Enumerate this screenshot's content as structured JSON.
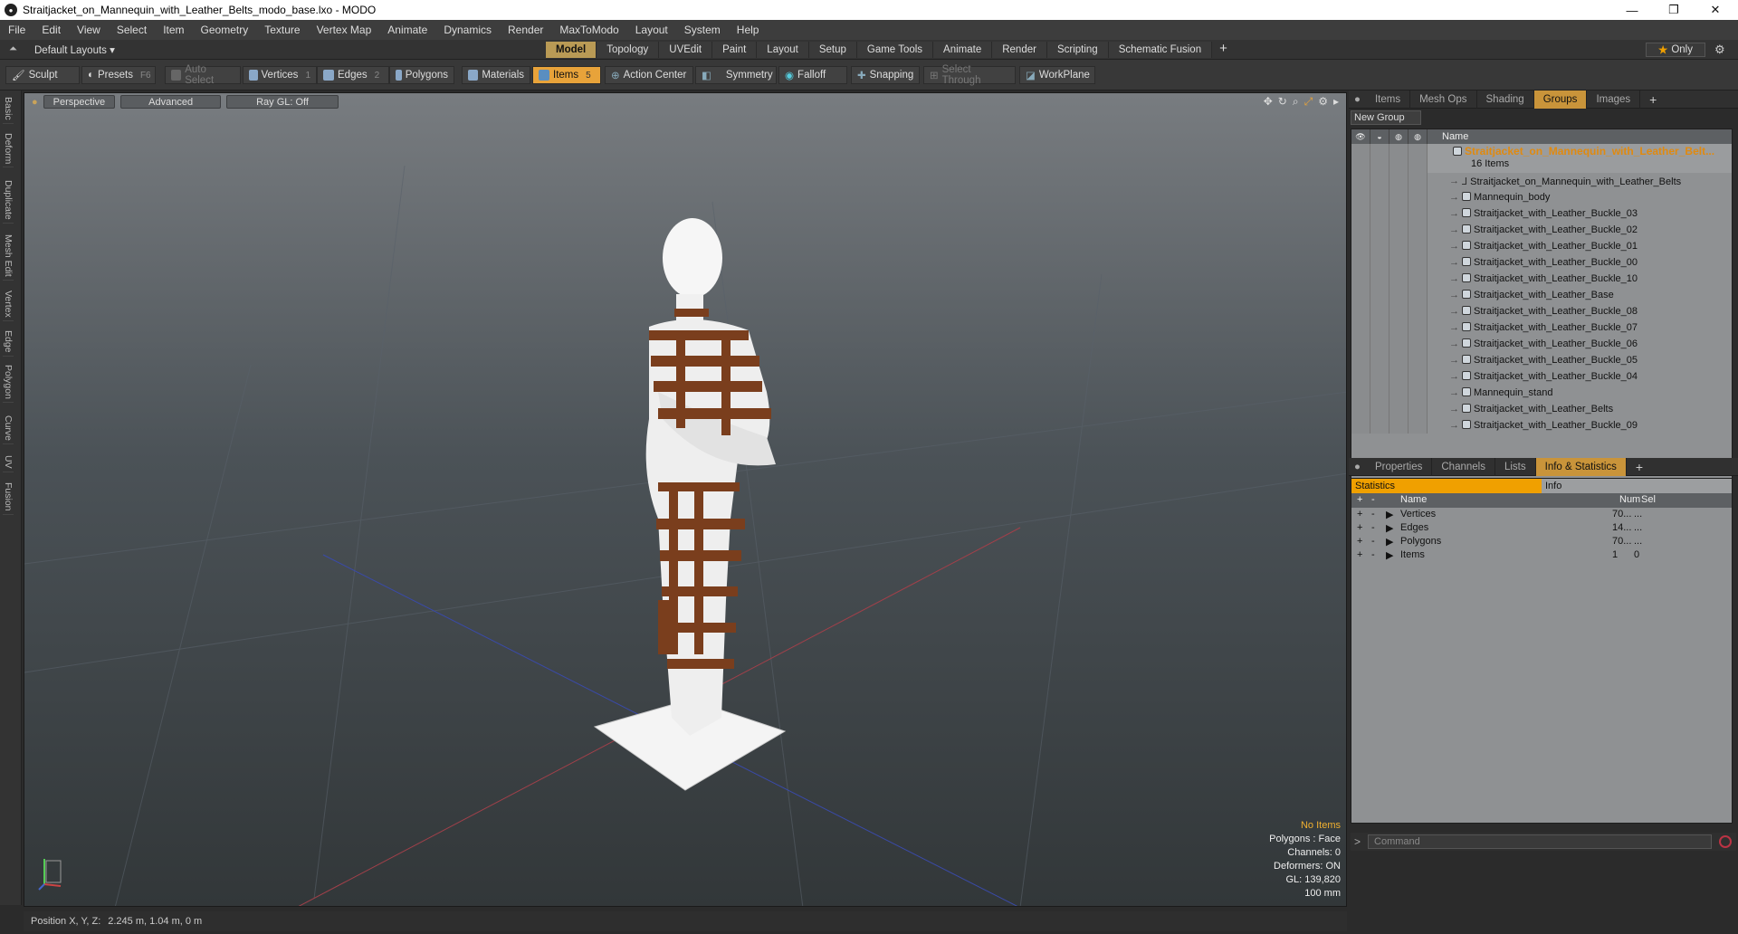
{
  "window": {
    "title": "Straitjacket_on_Mannequin_with_Leather_Belts_modo_base.lxo - MODO"
  },
  "menu": [
    "File",
    "Edit",
    "View",
    "Select",
    "Item",
    "Geometry",
    "Texture",
    "Vertex Map",
    "Animate",
    "Dynamics",
    "Render",
    "MaxToModo",
    "Layout",
    "System",
    "Help"
  ],
  "layout": {
    "name": "Default Layouts",
    "tabs": [
      "Model",
      "Topology",
      "UVEdit",
      "Paint",
      "Layout",
      "Setup",
      "Game Tools",
      "Animate",
      "Render",
      "Scripting",
      "Schematic Fusion"
    ],
    "active_tab": "Model",
    "plus": "+",
    "only": "Only",
    "only_star": "★"
  },
  "toolbar": {
    "sculpt": "Sculpt",
    "presets": "Presets",
    "presets_key": "F6",
    "auto_select": "Auto Select",
    "vertices": "Vertices",
    "vertices_key": "1",
    "edges": "Edges",
    "edges_key": "2",
    "polygons": "Polygons",
    "materials": "Materials",
    "items": "Items",
    "items_key": "5",
    "action_center": "Action Center",
    "symmetry": "Symmetry",
    "falloff": "Falloff",
    "snapping": "Snapping",
    "select_through": "Select Through",
    "workplane": "WorkPlane"
  },
  "left_tabs": [
    "Basic",
    "Deform",
    "Duplicate",
    "Mesh Edit",
    "Vertex",
    "Edge",
    "Polygon",
    "Curve",
    "UV",
    "Fusion"
  ],
  "viewport": {
    "view": "Perspective",
    "shading": "Advanced",
    "raygl": "Ray GL: Off",
    "info": {
      "no_items": "No Items",
      "polygons": "Polygons : Face",
      "channels": "Channels: 0",
      "deformers": "Deformers: ON",
      "gl": "GL: 139,820",
      "scale": "100 mm"
    }
  },
  "status": {
    "label": "Position X, Y, Z:",
    "value": "2.245 m, 1.04 m, 0 m"
  },
  "groups_panel": {
    "tabs": [
      "Items",
      "Mesh Ops",
      "Shading",
      "Groups",
      "Images"
    ],
    "active_tab": "Groups",
    "new_group": "New Group",
    "name_header": "Name",
    "root": {
      "name": "Straitjacket_on_Mannequin_with_Leather_Belt...",
      "count": "16 Items"
    },
    "items": [
      {
        "name": "Straitjacket_on_Mannequin_with_Leather_Belts",
        "type": "locator"
      },
      {
        "name": "Mannequin_body",
        "type": "mesh"
      },
      {
        "name": "Straitjacket_with_Leather_Buckle_03",
        "type": "mesh"
      },
      {
        "name": "Straitjacket_with_Leather_Buckle_02",
        "type": "mesh"
      },
      {
        "name": "Straitjacket_with_Leather_Buckle_01",
        "type": "mesh"
      },
      {
        "name": "Straitjacket_with_Leather_Buckle_00",
        "type": "mesh"
      },
      {
        "name": "Straitjacket_with_Leather_Buckle_10",
        "type": "mesh"
      },
      {
        "name": "Straitjacket_with_Leather_Base",
        "type": "mesh"
      },
      {
        "name": "Straitjacket_with_Leather_Buckle_08",
        "type": "mesh"
      },
      {
        "name": "Straitjacket_with_Leather_Buckle_07",
        "type": "mesh"
      },
      {
        "name": "Straitjacket_with_Leather_Buckle_06",
        "type": "mesh"
      },
      {
        "name": "Straitjacket_with_Leather_Buckle_05",
        "type": "mesh"
      },
      {
        "name": "Straitjacket_with_Leather_Buckle_04",
        "type": "mesh"
      },
      {
        "name": "Mannequin_stand",
        "type": "mesh"
      },
      {
        "name": "Straitjacket_with_Leather_Belts",
        "type": "mesh"
      },
      {
        "name": "Straitjacket_with_Leather_Buckle_09",
        "type": "mesh"
      }
    ]
  },
  "stats_panel": {
    "tabs": [
      "Properties",
      "Channels",
      "Lists",
      "Info & Statistics"
    ],
    "active_tab": "Info & Statistics",
    "subtabs": [
      "Statistics",
      "Info"
    ],
    "headers": {
      "name": "Name",
      "num": "Num",
      "sel": "Sel"
    },
    "rows": [
      {
        "name": "Vertices",
        "num": "70...",
        "sel": "..."
      },
      {
        "name": "Edges",
        "num": "14...",
        "sel": "..."
      },
      {
        "name": "Polygons",
        "num": "70...",
        "sel": "..."
      },
      {
        "name": "Items",
        "num": "1",
        "sel": "0"
      }
    ]
  },
  "command": {
    "placeholder": "Command"
  },
  "colors": {
    "accent": "#e8a33a",
    "root_text": "#e08a10",
    "belt": "#7a3e1d"
  }
}
